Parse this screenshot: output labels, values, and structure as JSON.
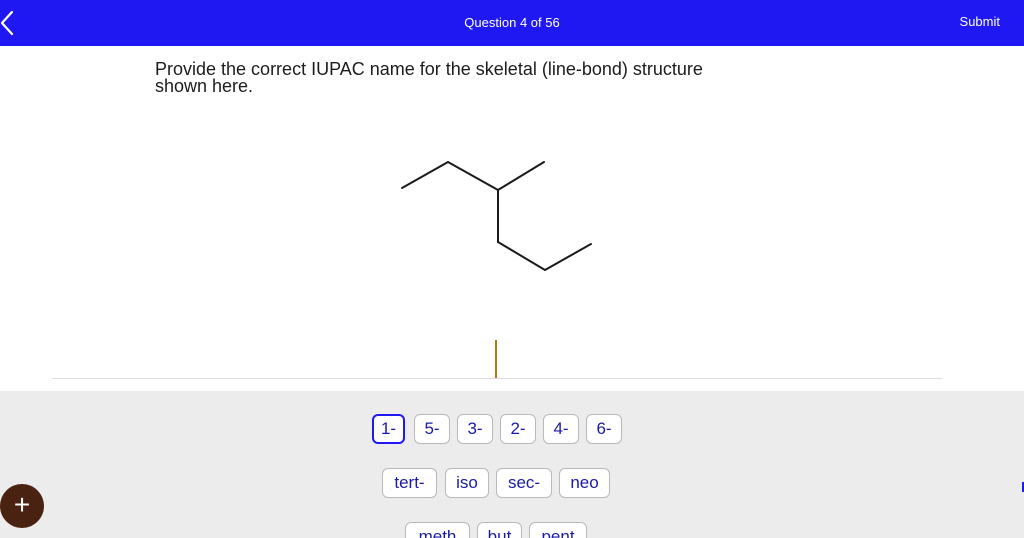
{
  "header": {
    "question_label": "Question 4 of 56",
    "submit_label": "Submit"
  },
  "prompt": {
    "line1": "Provide the correct IUPAC name for the skeletal (line-bond) structure",
    "line2": "shown here."
  },
  "keypad": {
    "locants": [
      "1-",
      "5-",
      "3-",
      "2-",
      "4-",
      "6-"
    ],
    "prefixes": [
      "tert-",
      "iso",
      "sec-",
      "neo"
    ],
    "roots": [
      "meth",
      "but",
      "pent"
    ],
    "add_symbol": "+"
  },
  "colors": {
    "header_bg": "#1f18f2",
    "key_text": "#1a1aa8",
    "keypad_bg": "#ececec",
    "add_button": "#4a2211",
    "cursor": "#b07a10"
  }
}
